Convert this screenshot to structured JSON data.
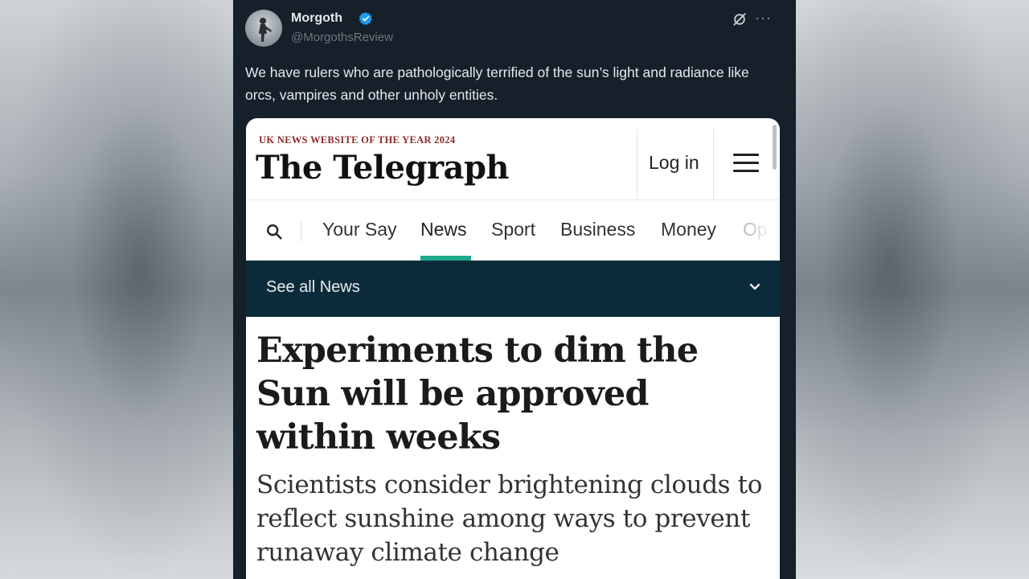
{
  "tweet": {
    "author_name": "Morgoth",
    "author_handle": "@MorgothsReview",
    "text": "We have rulers who are pathologically terrified of the sun’s light and radiance like orcs, vampires and other unholy entities.",
    "icons": {
      "verified": "verified-badge-icon",
      "grok": "grok-icon",
      "more": "more-options-icon"
    },
    "more_glyph": "···"
  },
  "article": {
    "award": "UK NEWS WEBSITE OF THE YEAR 2024",
    "logo": "The Telegraph",
    "login_label": "Log in",
    "nav_items": [
      "Your Say",
      "News",
      "Sport",
      "Business",
      "Money",
      "Op"
    ],
    "active_nav": "News",
    "section_label": "See all News",
    "headline": "Experiments to dim the Sun will be approved within weeks",
    "subheadline": "Scientists consider brightening clouds to reflect sunshine among ways to prevent runaway climate change",
    "colors": {
      "accent_underline": "#1ea88c",
      "section_bar": "#0c2b3a",
      "award_text": "#8b2c2c"
    }
  }
}
